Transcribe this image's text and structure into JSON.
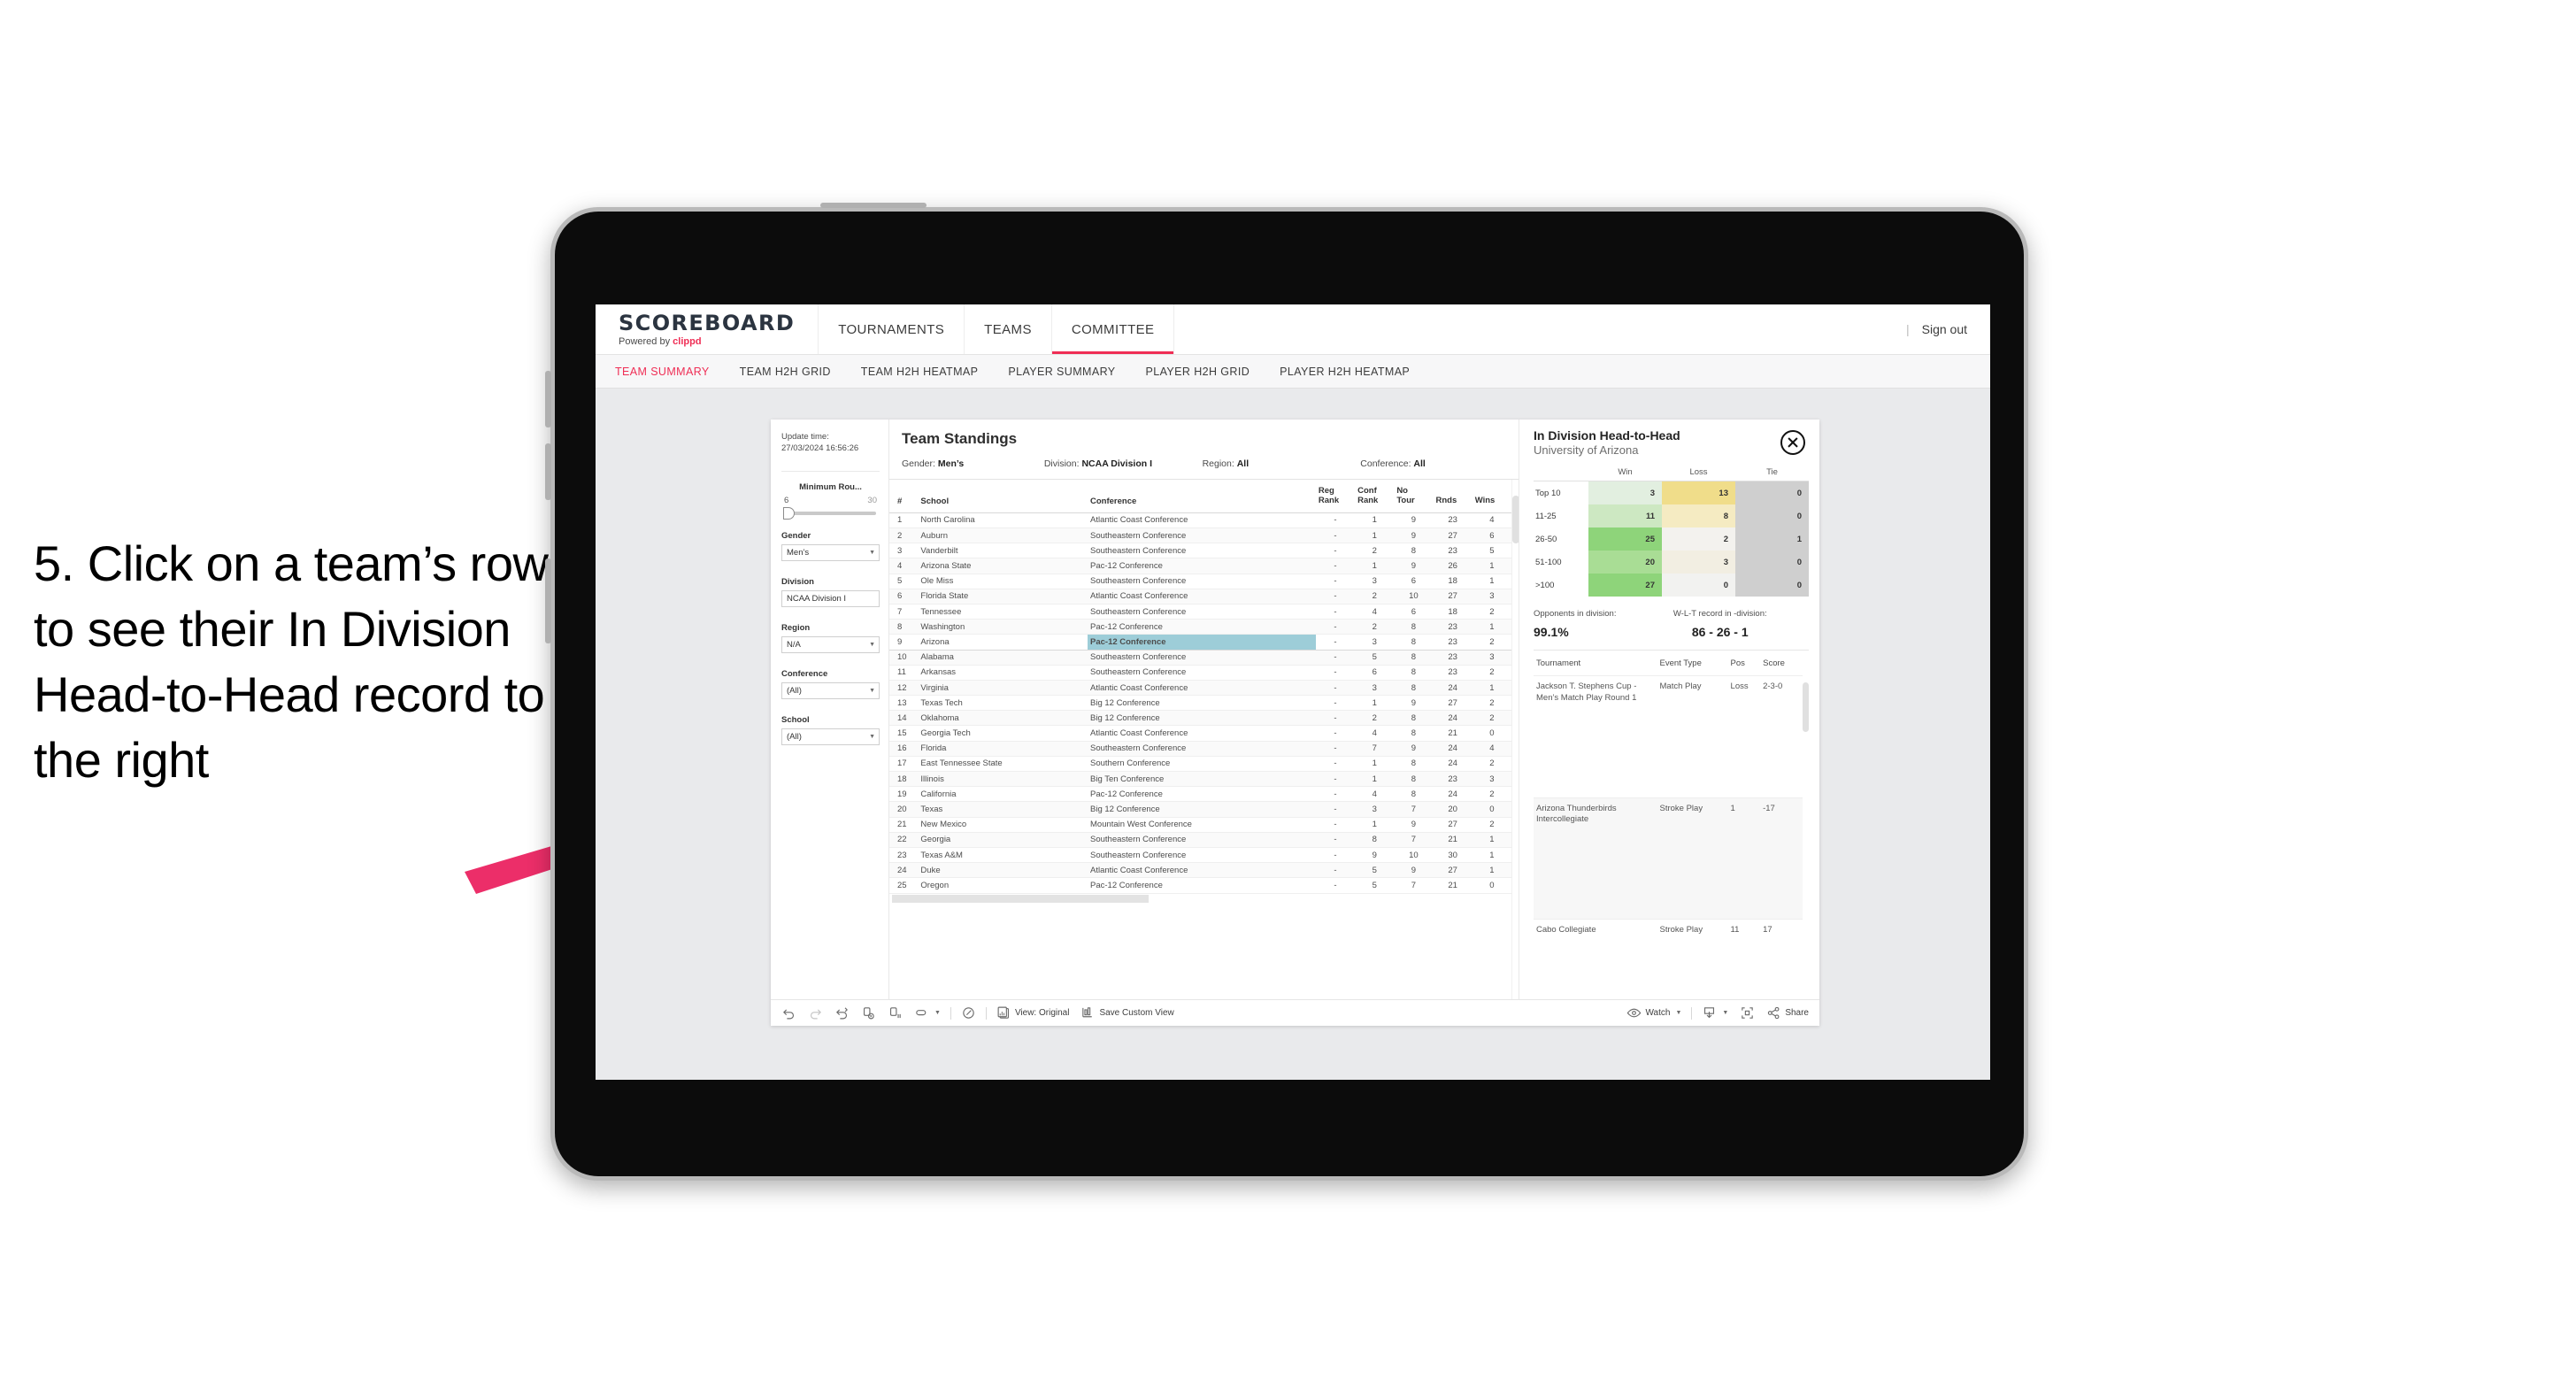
{
  "instruction": "5. Click on a team’s row to see their In Division Head-to-Head record to the right",
  "colors": {
    "accent": "#ef2e55",
    "arrow": "#ec2e69",
    "highlight_row": "#9dcdd8"
  },
  "topnav": {
    "brand_title": "SCOREBOARD",
    "brand_sub_prefix": "Powered by ",
    "brand_sub_name": "clippd",
    "items": [
      {
        "label": "TOURNAMENTS",
        "active": false
      },
      {
        "label": "TEAMS",
        "active": false
      },
      {
        "label": "COMMITTEE",
        "active": true
      }
    ],
    "divider": "|",
    "signout": "Sign out"
  },
  "subnav": {
    "items": [
      {
        "label": "TEAM SUMMARY",
        "active": true
      },
      {
        "label": "TEAM H2H GRID",
        "active": false
      },
      {
        "label": "TEAM H2H HEATMAP",
        "active": false
      },
      {
        "label": "PLAYER SUMMARY",
        "active": false
      },
      {
        "label": "PLAYER H2H GRID",
        "active": false
      },
      {
        "label": "PLAYER H2H HEATMAP",
        "active": false
      }
    ]
  },
  "filters": {
    "update_label": "Update time:",
    "update_time": "27/03/2024 16:56:26",
    "slider": {
      "title": "Minimum Rou...",
      "min": "6",
      "max": "30"
    },
    "groups": [
      {
        "title": "Gender",
        "value": "Men’s"
      },
      {
        "title": "Division",
        "value": "NCAA Division I"
      },
      {
        "title": "Region",
        "value": "N/A"
      },
      {
        "title": "Conference",
        "value": "(All)"
      },
      {
        "title": "School",
        "value": "(All)"
      }
    ]
  },
  "standings": {
    "title": "Team Standings",
    "meta": [
      {
        "label": "Gender:",
        "value": "Men’s"
      },
      {
        "label": "Division:",
        "value": "NCAA Division I"
      },
      {
        "label": "Region:",
        "value": "All"
      },
      {
        "label": "Conference:",
        "value": "All"
      }
    ],
    "columns": [
      "#",
      "School",
      "Conference",
      "Reg Rank",
      "Conf Rank",
      "No Tour",
      "Rnds",
      "Wins"
    ],
    "columns_wrapped": [
      {
        "l1": "#",
        "l2": ""
      },
      {
        "l1": "School",
        "l2": ""
      },
      {
        "l1": "Conference",
        "l2": ""
      },
      {
        "l1": "Reg",
        "l2": "Rank"
      },
      {
        "l1": "Conf",
        "l2": "Rank"
      },
      {
        "l1": "No",
        "l2": "Tour"
      },
      {
        "l1": "Rnds",
        "l2": ""
      },
      {
        "l1": "Wins",
        "l2": ""
      }
    ],
    "rows": [
      {
        "num": "1",
        "school": "North Carolina",
        "conf": "Atlantic Coast Conference",
        "reg": "-",
        "confrank": "1",
        "notour": "9",
        "rnds": "23",
        "wins": "4",
        "selected": false
      },
      {
        "num": "2",
        "school": "Auburn",
        "conf": "Southeastern Conference",
        "reg": "-",
        "confrank": "1",
        "notour": "9",
        "rnds": "27",
        "wins": "6",
        "selected": false
      },
      {
        "num": "3",
        "school": "Vanderbilt",
        "conf": "Southeastern Conference",
        "reg": "-",
        "confrank": "2",
        "notour": "8",
        "rnds": "23",
        "wins": "5",
        "selected": false
      },
      {
        "num": "4",
        "school": "Arizona State",
        "conf": "Pac-12 Conference",
        "reg": "-",
        "confrank": "1",
        "notour": "9",
        "rnds": "26",
        "wins": "1",
        "selected": false
      },
      {
        "num": "5",
        "school": "Ole Miss",
        "conf": "Southeastern Conference",
        "reg": "-",
        "confrank": "3",
        "notour": "6",
        "rnds": "18",
        "wins": "1",
        "selected": false
      },
      {
        "num": "6",
        "school": "Florida State",
        "conf": "Atlantic Coast Conference",
        "reg": "-",
        "confrank": "2",
        "notour": "10",
        "rnds": "27",
        "wins": "3",
        "selected": false
      },
      {
        "num": "7",
        "school": "Tennessee",
        "conf": "Southeastern Conference",
        "reg": "-",
        "confrank": "4",
        "notour": "6",
        "rnds": "18",
        "wins": "2",
        "selected": false
      },
      {
        "num": "8",
        "school": "Washington",
        "conf": "Pac-12 Conference",
        "reg": "-",
        "confrank": "2",
        "notour": "8",
        "rnds": "23",
        "wins": "1",
        "selected": false
      },
      {
        "num": "9",
        "school": "Arizona",
        "conf": "Pac-12 Conference",
        "reg": "-",
        "confrank": "3",
        "notour": "8",
        "rnds": "23",
        "wins": "2",
        "selected": true
      },
      {
        "num": "10",
        "school": "Alabama",
        "conf": "Southeastern Conference",
        "reg": "-",
        "confrank": "5",
        "notour": "8",
        "rnds": "23",
        "wins": "3",
        "selected": false
      },
      {
        "num": "11",
        "school": "Arkansas",
        "conf": "Southeastern Conference",
        "reg": "-",
        "confrank": "6",
        "notour": "8",
        "rnds": "23",
        "wins": "2",
        "selected": false
      },
      {
        "num": "12",
        "school": "Virginia",
        "conf": "Atlantic Coast Conference",
        "reg": "-",
        "confrank": "3",
        "notour": "8",
        "rnds": "24",
        "wins": "1",
        "selected": false
      },
      {
        "num": "13",
        "school": "Texas Tech",
        "conf": "Big 12 Conference",
        "reg": "-",
        "confrank": "1",
        "notour": "9",
        "rnds": "27",
        "wins": "2",
        "selected": false
      },
      {
        "num": "14",
        "school": "Oklahoma",
        "conf": "Big 12 Conference",
        "reg": "-",
        "confrank": "2",
        "notour": "8",
        "rnds": "24",
        "wins": "2",
        "selected": false
      },
      {
        "num": "15",
        "school": "Georgia Tech",
        "conf": "Atlantic Coast Conference",
        "reg": "-",
        "confrank": "4",
        "notour": "8",
        "rnds": "21",
        "wins": "0",
        "selected": false
      },
      {
        "num": "16",
        "school": "Florida",
        "conf": "Southeastern Conference",
        "reg": "-",
        "confrank": "7",
        "notour": "9",
        "rnds": "24",
        "wins": "4",
        "selected": false
      },
      {
        "num": "17",
        "school": "East Tennessee State",
        "conf": "Southern Conference",
        "reg": "-",
        "confrank": "1",
        "notour": "8",
        "rnds": "24",
        "wins": "2",
        "selected": false
      },
      {
        "num": "18",
        "school": "Illinois",
        "conf": "Big Ten Conference",
        "reg": "-",
        "confrank": "1",
        "notour": "8",
        "rnds": "23",
        "wins": "3",
        "selected": false
      },
      {
        "num": "19",
        "school": "California",
        "conf": "Pac-12 Conference",
        "reg": "-",
        "confrank": "4",
        "notour": "8",
        "rnds": "24",
        "wins": "2",
        "selected": false
      },
      {
        "num": "20",
        "school": "Texas",
        "conf": "Big 12 Conference",
        "reg": "-",
        "confrank": "3",
        "notour": "7",
        "rnds": "20",
        "wins": "0",
        "selected": false
      },
      {
        "num": "21",
        "school": "New Mexico",
        "conf": "Mountain West Conference",
        "reg": "-",
        "confrank": "1",
        "notour": "9",
        "rnds": "27",
        "wins": "2",
        "selected": false
      },
      {
        "num": "22",
        "school": "Georgia",
        "conf": "Southeastern Conference",
        "reg": "-",
        "confrank": "8",
        "notour": "7",
        "rnds": "21",
        "wins": "1",
        "selected": false
      },
      {
        "num": "23",
        "school": "Texas A&M",
        "conf": "Southeastern Conference",
        "reg": "-",
        "confrank": "9",
        "notour": "10",
        "rnds": "30",
        "wins": "1",
        "selected": false
      },
      {
        "num": "24",
        "school": "Duke",
        "conf": "Atlantic Coast Conference",
        "reg": "-",
        "confrank": "5",
        "notour": "9",
        "rnds": "27",
        "wins": "1",
        "selected": false
      },
      {
        "num": "25",
        "school": "Oregon",
        "conf": "Pac-12 Conference",
        "reg": "-",
        "confrank": "5",
        "notour": "7",
        "rnds": "21",
        "wins": "0",
        "selected": false
      }
    ]
  },
  "h2h": {
    "title": "In Division Head-to-Head",
    "subtitle": "University of Arizona",
    "close_icon": "close-circle-icon",
    "columns": [
      "",
      "Win",
      "Loss",
      "Tie"
    ],
    "rows": [
      {
        "label": "Top 10",
        "win": "3",
        "loss": "13",
        "tie": "0",
        "win_bg": "#e2efe0",
        "loss_bg": "#f0dd8a",
        "tie_bg": "#cfcfcf"
      },
      {
        "label": "11-25",
        "win": "11",
        "loss": "8",
        "tie": "0",
        "win_bg": "#cde8c2",
        "loss_bg": "#f5ebc2",
        "tie_bg": "#cfcfcf"
      },
      {
        "label": "26-50",
        "win": "25",
        "loss": "2",
        "tie": "1",
        "win_bg": "#8ed47a",
        "loss_bg": "#f3f2ee",
        "tie_bg": "#cfcfcf"
      },
      {
        "label": "51-100",
        "win": "20",
        "loss": "3",
        "tie": "0",
        "win_bg": "#a9dd95",
        "loss_bg": "#f2eee2",
        "tie_bg": "#cfcfcf"
      },
      {
        "label": ">100",
        "win": "27",
        "loss": "0",
        "tie": "0",
        "win_bg": "#8ed47a",
        "loss_bg": "#f2f2f0",
        "tie_bg": "#cfcfcf"
      }
    ],
    "stats": {
      "opp_label": "Opponents in division:",
      "opp_value": "99.1%",
      "wlt_label": "W-L-T record in -division:",
      "wlt_value": "86 - 26 - 1"
    },
    "tournaments": {
      "columns": [
        "Tournament",
        "Event Type",
        "Pos",
        "Score"
      ],
      "rows": [
        {
          "name": "Jackson T. Stephens Cup - Men’s Match Play Round 1",
          "type": "Match Play",
          "pos": "Loss",
          "score": "2-3-0"
        },
        {
          "name": "Arizona Thunderbirds Intercollegiate",
          "type": "Stroke Play",
          "pos": "1",
          "score": "-17"
        },
        {
          "name": "Cabo Collegiate",
          "type": "Stroke Play",
          "pos": "11",
          "score": "17"
        }
      ]
    }
  },
  "toolbar": {
    "left": [
      {
        "icon": "undo-icon",
        "label": ""
      },
      {
        "icon": "redo-icon",
        "label": ""
      },
      {
        "icon": "revert-icon",
        "label": ""
      },
      {
        "icon": "refresh-data-icon",
        "label": ""
      },
      {
        "icon": "pause-updates-icon",
        "label": ""
      },
      {
        "icon": "highlight-icon",
        "label": ""
      }
    ],
    "alert_icon": "alert-clock-icon",
    "view_icon": "view-icon",
    "view_label": "View: Original",
    "save_icon": "save-custom-view-icon",
    "save_label": "Save Custom View",
    "watch_icon": "eye-icon",
    "watch_label": "Watch",
    "download_icon": "download-icon",
    "fullscreen_icon": "fullscreen-icon",
    "share_icon": "share-icon",
    "share_label": "Share"
  }
}
